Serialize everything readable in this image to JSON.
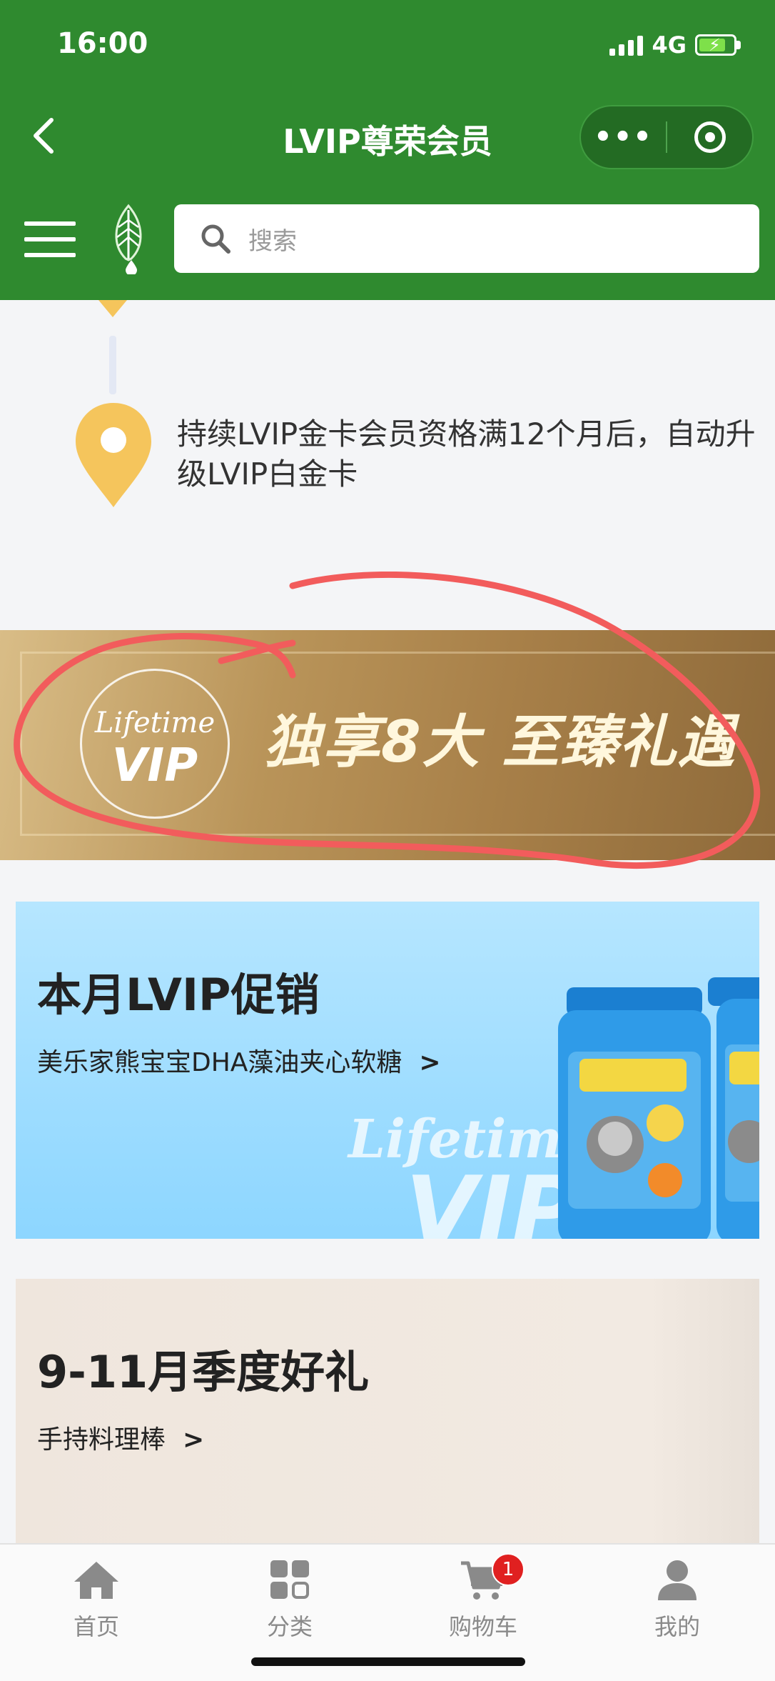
{
  "status_bar": {
    "time": "16:00",
    "network": "4G"
  },
  "nav": {
    "title": "LVIP尊荣会员",
    "more_label": "•••"
  },
  "search": {
    "placeholder": "搜索"
  },
  "timeline": {
    "milestone_text": "持续LVIP金卡会员资格满12个月后，自动升级LVIP白金卡"
  },
  "gold_banner": {
    "badge_line1": "Lifetime",
    "badge_line2": "VIP",
    "slogan": "独享8大 至臻礼遇"
  },
  "promo_card": {
    "title": "本月LVIP促销",
    "subtitle": "美乐家熊宝宝DHA藻油夹心软糖",
    "arrow": ">",
    "watermark_line1": "Lifetime",
    "watermark_line2": "VIP"
  },
  "season_card": {
    "title": "9-11月季度好礼",
    "subtitle": "手持料理棒",
    "arrow": ">"
  },
  "tabbar": {
    "tabs": [
      {
        "label": "首页",
        "icon": "home-icon"
      },
      {
        "label": "分类",
        "icon": "grid-icon"
      },
      {
        "label": "购物车",
        "icon": "cart-icon",
        "badge": "1"
      },
      {
        "label": "我的",
        "icon": "user-icon"
      }
    ]
  },
  "colors": {
    "header_green": "#2f8a2f",
    "gold": "#b99459",
    "pin_yellow": "#f5c55c",
    "annotation_red": "#f25c5c"
  }
}
